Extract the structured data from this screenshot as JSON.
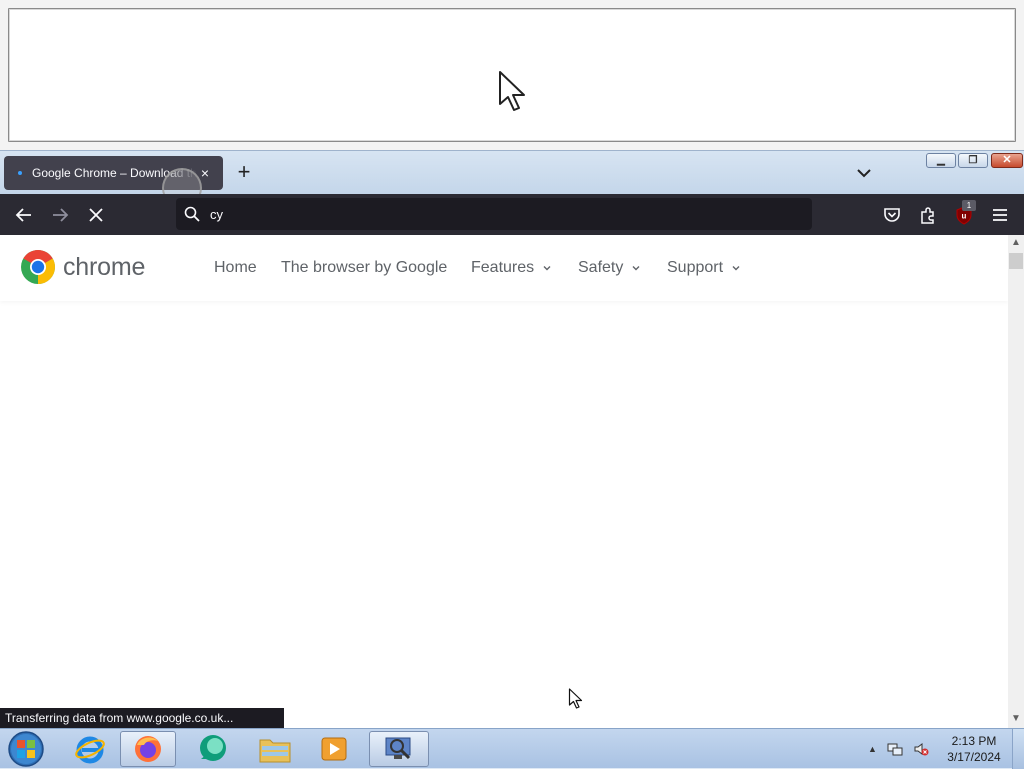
{
  "tab": {
    "title": "Google Chrome – Download the fast, secure browser from Google",
    "close": "×"
  },
  "toolbar": {
    "new_tab": "+",
    "url_text": "cy",
    "ublock_count": "1"
  },
  "site": {
    "logo_text": "chrome",
    "nav": [
      {
        "label": "Home",
        "has_dropdown": false
      },
      {
        "label": "The browser by Google",
        "has_dropdown": false
      },
      {
        "label": "Features",
        "has_dropdown": true
      },
      {
        "label": "Safety",
        "has_dropdown": true
      },
      {
        "label": "Support",
        "has_dropdown": true
      }
    ]
  },
  "status_bar": "Transferring data from www.google.co.uk...",
  "taskbar": {
    "apps": [
      "start-orb",
      "internet-explorer",
      "firefox",
      "app-bubble",
      "file-explorer",
      "media-player",
      "remote-tool"
    ],
    "time": "2:13 PM",
    "date": "3/17/2024"
  },
  "colors": {
    "toolbar_bg": "#2b2a33",
    "urlbar_bg": "#1c1b22",
    "tab_bg": "#42414d",
    "text_gray": "#5f6368"
  }
}
